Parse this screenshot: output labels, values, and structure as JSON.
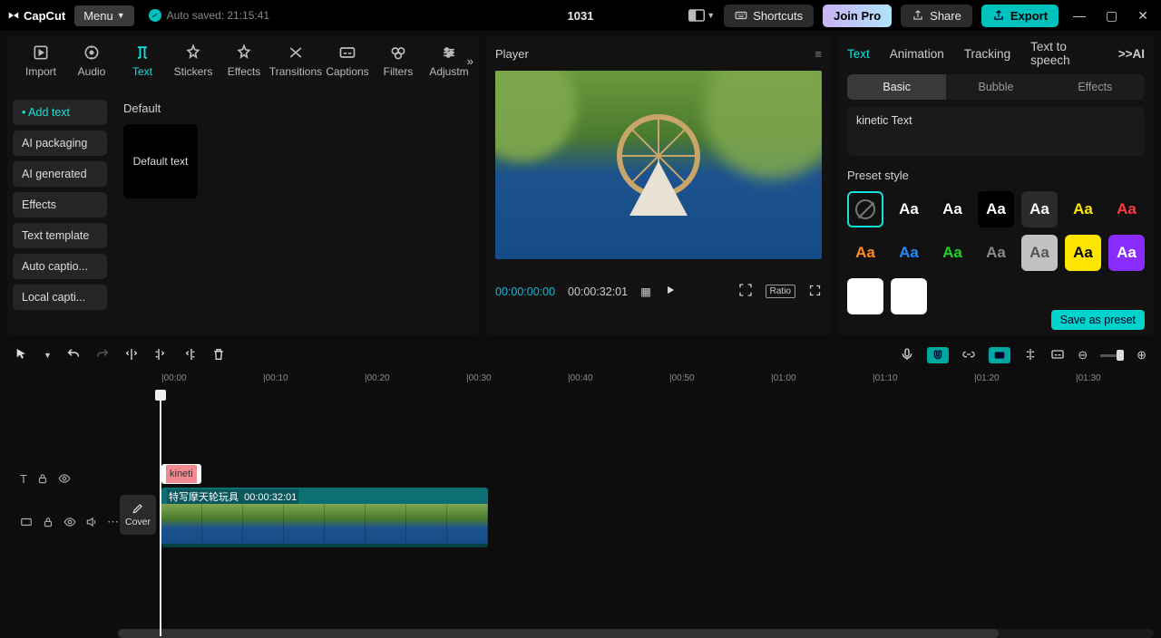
{
  "titlebar": {
    "app_name": "CapCut",
    "menu_label": "Menu",
    "auto_saved": "Auto saved: 21:15:41",
    "project_title": "1031",
    "shortcuts": "Shortcuts",
    "join_pro": "Join Pro",
    "share": "Share",
    "export": "Export"
  },
  "media_tabs": [
    "Import",
    "Audio",
    "Text",
    "Stickers",
    "Effects",
    "Transitions",
    "Captions",
    "Filters",
    "Adjustm"
  ],
  "media_tabs_active": 2,
  "text_sidebar": {
    "items": [
      "Add text",
      "AI packaging",
      "AI generated",
      "Effects",
      "Text template",
      "Auto captio...",
      "Local capti..."
    ],
    "active": 0,
    "section_label": "Default",
    "default_text_card": "Default text"
  },
  "player": {
    "title": "Player",
    "current_time": "00:00:00:00",
    "total_time": "00:00:32:01",
    "ratio_label": "Ratio"
  },
  "inspector": {
    "tabs": [
      "Text",
      "Animation",
      "Tracking",
      "Text to speech"
    ],
    "tabs_active": 0,
    "ai_suffix": ">>AI",
    "subtabs": [
      "Basic",
      "Bubble",
      "Effects"
    ],
    "subtabs_active": 0,
    "text_value": "kinetic Text",
    "preset_label": "Preset style",
    "presets": [
      {
        "kind": "none"
      },
      {
        "txt": "Aa",
        "fg": "#fff",
        "bg": "#111"
      },
      {
        "txt": "Aa",
        "fg": "#fff",
        "bg": "#111",
        "stroke": "#000"
      },
      {
        "txt": "Aa",
        "fg": "#fff",
        "bg": "#000"
      },
      {
        "txt": "Aa",
        "fg": "#fff",
        "bg": "#2b2b2b"
      },
      {
        "txt": "Aa",
        "fg": "#ffe600",
        "bg": "#111"
      },
      {
        "txt": "Aa",
        "fg": "#ff3b3b",
        "bg": "#111"
      },
      {
        "txt": "Aa",
        "fg": "#ff8a1f",
        "bg": "#111"
      },
      {
        "txt": "Aa",
        "fg": "#1f8bff",
        "bg": "#111"
      },
      {
        "txt": "Aa",
        "fg": "#18d41f",
        "bg": "#111"
      },
      {
        "txt": "Aa",
        "fg": "#888",
        "bg": "#111"
      },
      {
        "txt": "Aa",
        "fg": "#555",
        "bg": "#c2c2c2"
      },
      {
        "txt": "Aa",
        "fg": "#000",
        "bg": "#ffe600"
      },
      {
        "txt": "Aa",
        "fg": "#fff",
        "bg": "#8a2cff"
      },
      {
        "txt": "",
        "fg": "#fff",
        "bg": "#fff"
      },
      {
        "txt": "",
        "fg": "#fff",
        "bg": "#fff"
      },
      {
        "txt": "",
        "fg": "#0f0",
        "bg": "#111"
      },
      {
        "txt": "",
        "fg": "#0f0",
        "bg": "#111"
      },
      {
        "txt": "",
        "fg": "#fff",
        "bg": "#111"
      },
      {
        "txt": "",
        "fg": "#fff",
        "bg": "#111"
      },
      {
        "txt": "",
        "fg": "#fff",
        "bg": "#111"
      }
    ],
    "save_preset": "Save as preset"
  },
  "timeline": {
    "ruler": [
      "|00:00",
      "|00:10",
      "|00:20",
      "|00:30",
      "|00:40",
      "|00:50",
      "|01:00",
      "|01:10",
      "|01:20",
      "|01:30"
    ],
    "cover_label": "Cover",
    "text_clip_label": "kineti",
    "video_clip_name": "特写摩天轮玩具",
    "video_clip_dur": "00:00:32:01"
  }
}
